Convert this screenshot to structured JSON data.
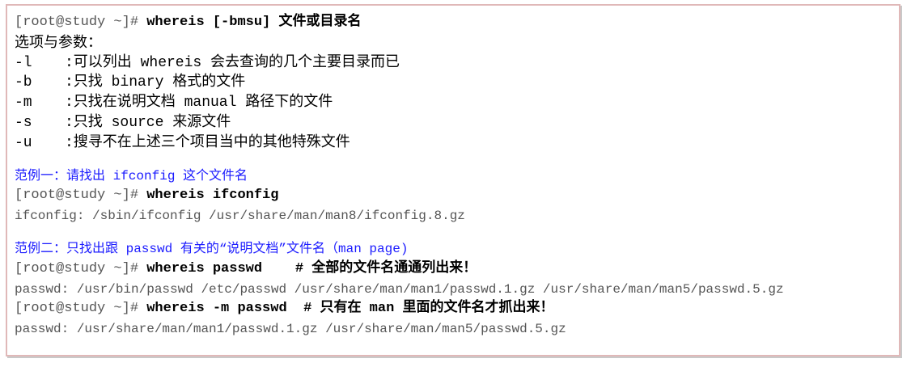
{
  "lines": {
    "syntax": {
      "prompt": "[root@study ~]#",
      "command": "whereis [-bmsu] 文件或目录名"
    },
    "options_header": "选项与参数：",
    "options": [
      {
        "flag": "-l",
        "desc": ":可以列出 whereis 会去查询的几个主要目录而已"
      },
      {
        "flag": "-b",
        "desc": ":只找 binary 格式的文件"
      },
      {
        "flag": "-m",
        "desc": ":只找在说明文档 manual 路径下的文件"
      },
      {
        "flag": "-s",
        "desc": ":只找 source 来源文件"
      },
      {
        "flag": "-u",
        "desc": ":搜寻不在上述三个项目当中的其他特殊文件"
      }
    ],
    "example1": {
      "title": "范例一：请找出 ifconfig 这个文件名",
      "prompt": "[root@study ~]#",
      "command": "whereis ifconfig",
      "output": "ifconfig: /sbin/ifconfig /usr/share/man/man8/ifconfig.8.gz"
    },
    "example2": {
      "title": "范例二：只找出跟 passwd 有关的“说明文档”文件名（man page)",
      "prompt1": "[root@study ~]#",
      "command1": "whereis passwd    # 全部的文件名通通列出来！",
      "output1": "passwd: /usr/bin/passwd /etc/passwd /usr/share/man/man1/passwd.1.gz /usr/share/man/man5/passwd.5.gz",
      "prompt2": "[root@study ~]#",
      "command2": "whereis -m passwd  # 只有在 man 里面的文件名才抓出来！",
      "output2": "passwd: /usr/share/man/man1/passwd.1.gz /usr/share/man/man5/passwd.5.gz"
    }
  },
  "colors": {
    "frame_border": "#e0b8b8",
    "example_title": "#1a1aff",
    "output_text": "#555555"
  }
}
